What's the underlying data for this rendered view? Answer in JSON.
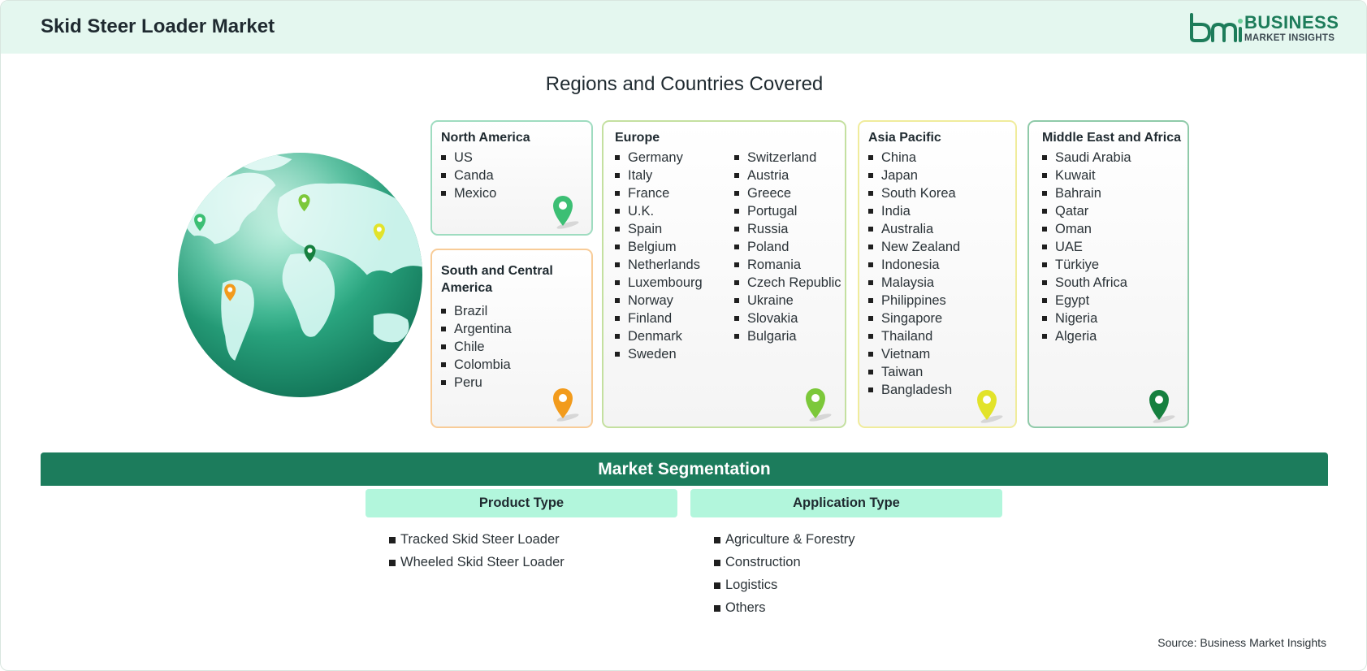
{
  "header": {
    "title": "Skid Steer Loader Market",
    "logo_line1": "BUSINESS",
    "logo_line2": "MARKET INSIGHTS"
  },
  "regions_title": "Regions and Countries Covered",
  "regions": {
    "north_america": {
      "title": "North America",
      "countries": [
        "US",
        "Canda",
        "Mexico"
      ],
      "pin_color": "#3cbf74"
    },
    "south_central_america": {
      "title": "South and Central America",
      "countries": [
        "Brazil",
        "Argentina",
        "Chile",
        "Colombia",
        "Peru"
      ],
      "pin_color": "#f29b1c"
    },
    "europe": {
      "title": "Europe",
      "countries_col1": [
        "Germany",
        "Italy",
        "France",
        "U.K.",
        "Spain",
        "Belgium",
        "Netherlands",
        "Luxembourg",
        "Norway",
        "Finland",
        "Denmark",
        "Sweden"
      ],
      "countries_col2": [
        "Switzerland",
        "Austria",
        "Greece",
        "Portugal",
        "Russia",
        "Poland",
        "Romania",
        "Czech Republic",
        "Ukraine",
        "Slovakia",
        "Bulgaria"
      ],
      "pin_color": "#7cc83a"
    },
    "asia_pacific": {
      "title": "Asia Pacific",
      "countries": [
        "China",
        "Japan",
        "South Korea",
        "India",
        "Australia",
        "New Zealand",
        "Indonesia",
        "Malaysia",
        "Philippines",
        "Singapore",
        "Thailand",
        "Vietnam",
        "Taiwan",
        "Bangladesh"
      ],
      "pin_color": "#e2e32a"
    },
    "middle_east_africa": {
      "title": "Middle East and Africa",
      "countries": [
        "Saudi Arabia",
        "Kuwait",
        "Bahrain",
        "Qatar",
        "Oman",
        "UAE",
        "Türkiye",
        "South Africa",
        "Egypt",
        "Nigeria",
        "Algeria"
      ],
      "pin_color": "#16803f"
    }
  },
  "segmentation": {
    "title": "Market Segmentation",
    "product_type": {
      "title": "Product Type",
      "items": [
        "Tracked Skid Steer Loader",
        "Wheeled Skid Steer Loader"
      ]
    },
    "application_type": {
      "title": "Application Type",
      "items": [
        "Agriculture & Forestry",
        "Construction",
        "Logistics",
        "Others"
      ]
    }
  },
  "source": "Source: Business Market Insights",
  "colors": {
    "header_bg": "#e4f7ef",
    "brand_green": "#1c7c5c",
    "segment_head_bg": "#b2f6dc"
  }
}
